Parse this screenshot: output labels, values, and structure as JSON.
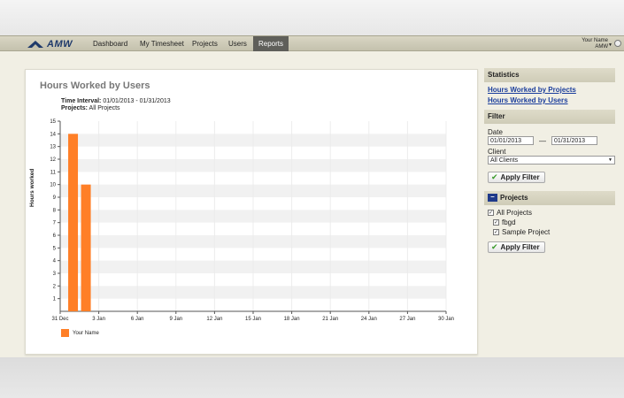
{
  "app": {
    "logo_text": "AMW"
  },
  "nav": {
    "items": [
      {
        "label": "Dashboard"
      },
      {
        "label": "My Timesheet"
      },
      {
        "label": "Projects"
      },
      {
        "label": "Users"
      },
      {
        "label": "Reports",
        "active": true
      }
    ]
  },
  "user": {
    "name": "Your Name",
    "org": "AMW"
  },
  "report": {
    "title": "Hours Worked by Users",
    "time_interval_label": "Time Interval:",
    "time_interval_value": "01/01/2013 - 01/31/2013",
    "projects_label": "Projects:",
    "projects_value": "All Projects"
  },
  "chart_data": {
    "type": "bar",
    "ylabel": "Hours worked",
    "ylim": [
      0,
      15
    ],
    "yticks": [
      1,
      2,
      3,
      4,
      5,
      6,
      7,
      8,
      9,
      10,
      11,
      12,
      13,
      14,
      15
    ],
    "xticks": [
      "31 Dec",
      "3 Jan",
      "6 Jan",
      "9 Jan",
      "12 Jan",
      "15 Jan",
      "18 Jan",
      "21 Jan",
      "24 Jan",
      "27 Jan",
      "30 Jan"
    ],
    "series": [
      {
        "name": "Your Name",
        "color": "#ff7f27",
        "points": [
          {
            "date": "2013-01-01",
            "value": 14
          },
          {
            "date": "2013-01-02",
            "value": 10
          }
        ]
      }
    ],
    "legend": "bottom-left"
  },
  "sidebar": {
    "statistics": {
      "title": "Statistics",
      "links": [
        {
          "label": "Hours Worked by Projects"
        },
        {
          "label": "Hours Worked by Users"
        }
      ]
    },
    "filter": {
      "title": "Filter",
      "date_label": "Date",
      "date_from": "01/01/2013",
      "date_sep": "—",
      "date_to": "01/31/2013",
      "client_label": "Client",
      "client_value": "All Clients",
      "apply_label": "Apply Filter"
    },
    "projects": {
      "title": "Projects",
      "toggle_symbol": "–",
      "all_label": "All Projects",
      "items": [
        {
          "label": "fbgd",
          "checked": true
        },
        {
          "label": "Sample Project",
          "checked": true
        }
      ],
      "apply_label": "Apply Filter"
    }
  },
  "colors": {
    "accent": "#ff7f27",
    "link": "#1b3e9c",
    "nav_active": "#5f5f5a"
  }
}
